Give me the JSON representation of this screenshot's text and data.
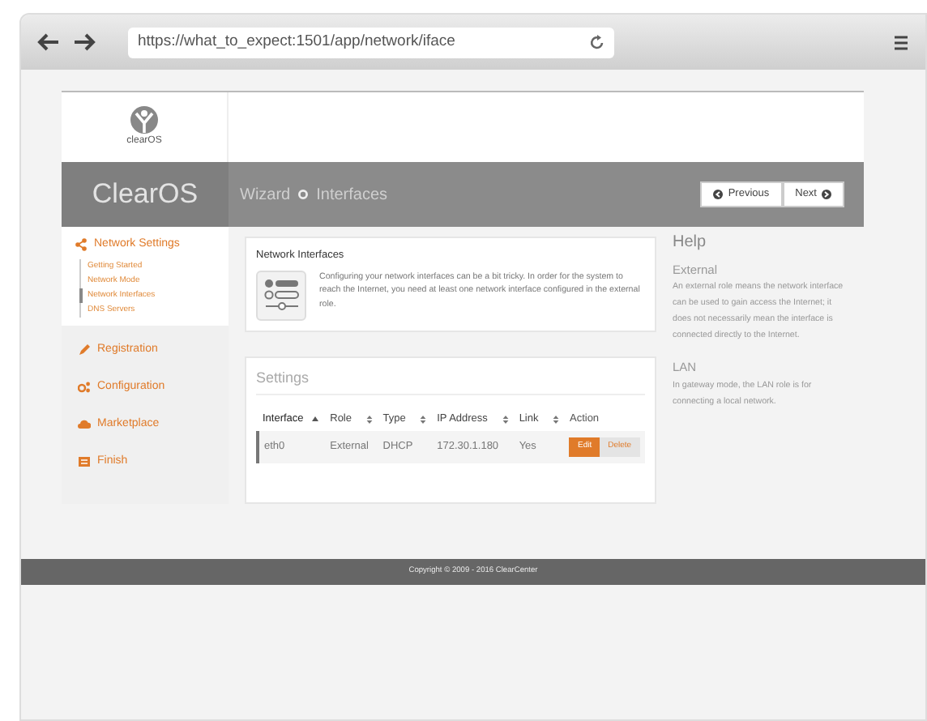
{
  "browser": {
    "url": "https://what_to_expect:1501/app/network/iface"
  },
  "brand": {
    "logo_caption": "clearOS",
    "title": "ClearOS"
  },
  "breadcrumb": [
    "Wizard",
    "Interfaces"
  ],
  "wizard_buttons": [
    {
      "label": "Previous",
      "kind": "previous"
    },
    {
      "label": "Next",
      "kind": "next"
    }
  ],
  "sidebar": {
    "items": [
      {
        "label": "Network Settings",
        "kind": "share",
        "expanded": true,
        "children": [
          {
            "label": "Getting Started",
            "selected": false
          },
          {
            "label": "Network Mode",
            "selected": false
          },
          {
            "label": "Network Interfaces",
            "selected": true
          },
          {
            "label": "DNS Servers",
            "selected": false
          }
        ]
      },
      {
        "label": "Registration",
        "kind": "pencil",
        "expanded": false
      },
      {
        "label": "Configuration",
        "kind": "cogs",
        "expanded": false
      },
      {
        "label": "Marketplace",
        "kind": "cloud",
        "expanded": false
      },
      {
        "label": "Finish",
        "kind": "list",
        "expanded": false
      }
    ]
  },
  "intro": {
    "title": "Network Interfaces",
    "text": "Configuring your network interfaces can be a bit tricky. In order for the system to reach the Internet, you need at least one network interface configured in the external role."
  },
  "settings": {
    "title": "Settings",
    "table": {
      "columns": [
        {
          "label": "Interface",
          "sortable": true,
          "sorted": true
        },
        {
          "label": "Role",
          "sortable": true,
          "sorted": false
        },
        {
          "label": "Type",
          "sortable": true,
          "sorted": false
        },
        {
          "label": "IP Address",
          "sortable": true,
          "sorted": false
        },
        {
          "label": "Link",
          "sortable": true,
          "sorted": false
        },
        {
          "label": "Action",
          "sortable": false,
          "sorted": false
        }
      ],
      "rows": [
        {
          "cells": [
            "eth0",
            "External",
            "DHCP",
            "172.30.1.180",
            "Yes"
          ],
          "actions": [
            "Edit",
            "Delete"
          ]
        }
      ]
    }
  },
  "help": {
    "title": "Help",
    "sections": [
      {
        "heading": "External",
        "text": "An external role means the network interface can be used to gain access the Internet; it does not necessarily mean the interface is connected directly to the Internet."
      },
      {
        "heading": "LAN",
        "text": "In gateway mode, the LAN role is for connecting a local network."
      }
    ]
  },
  "footer": "Copyright © 2009 - 2016 ClearCenter"
}
